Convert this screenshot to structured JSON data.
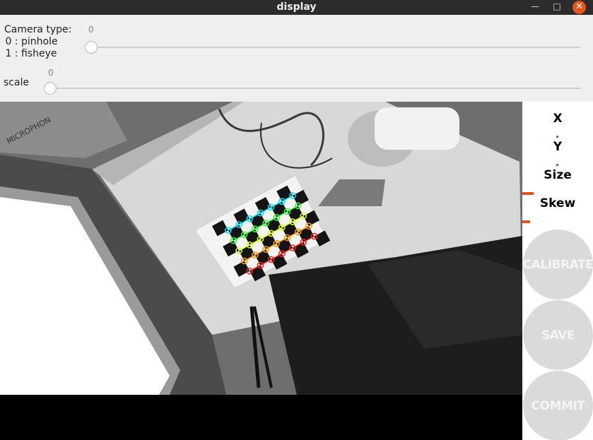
{
  "window": {
    "title": "display",
    "minimize_glyph": "—",
    "maximize_glyph": "□",
    "close_glyph": "✕"
  },
  "camera_type": {
    "label": "Camera type:",
    "option_0": " 0 : pinhole",
    "option_1": " 1 : fisheye",
    "value": "0",
    "slider_level": 0
  },
  "scale": {
    "label": "scale",
    "value": "0",
    "slider_level": 0
  },
  "image_overlay": {
    "box_text": "MICROPHON"
  },
  "metrics": {
    "x_label": "X",
    "y_label": "Y",
    "size_label": "Size",
    "skew_label": "Skew"
  },
  "buttons": {
    "calibrate": "CALIBRATE",
    "save": "SAVE",
    "commit": "COMMIT"
  },
  "colors": {
    "titlebar": "#2c2c2c",
    "close_button": "#e9541f",
    "progress_mark": "#e8501e",
    "button_disabled": "#dadada"
  }
}
